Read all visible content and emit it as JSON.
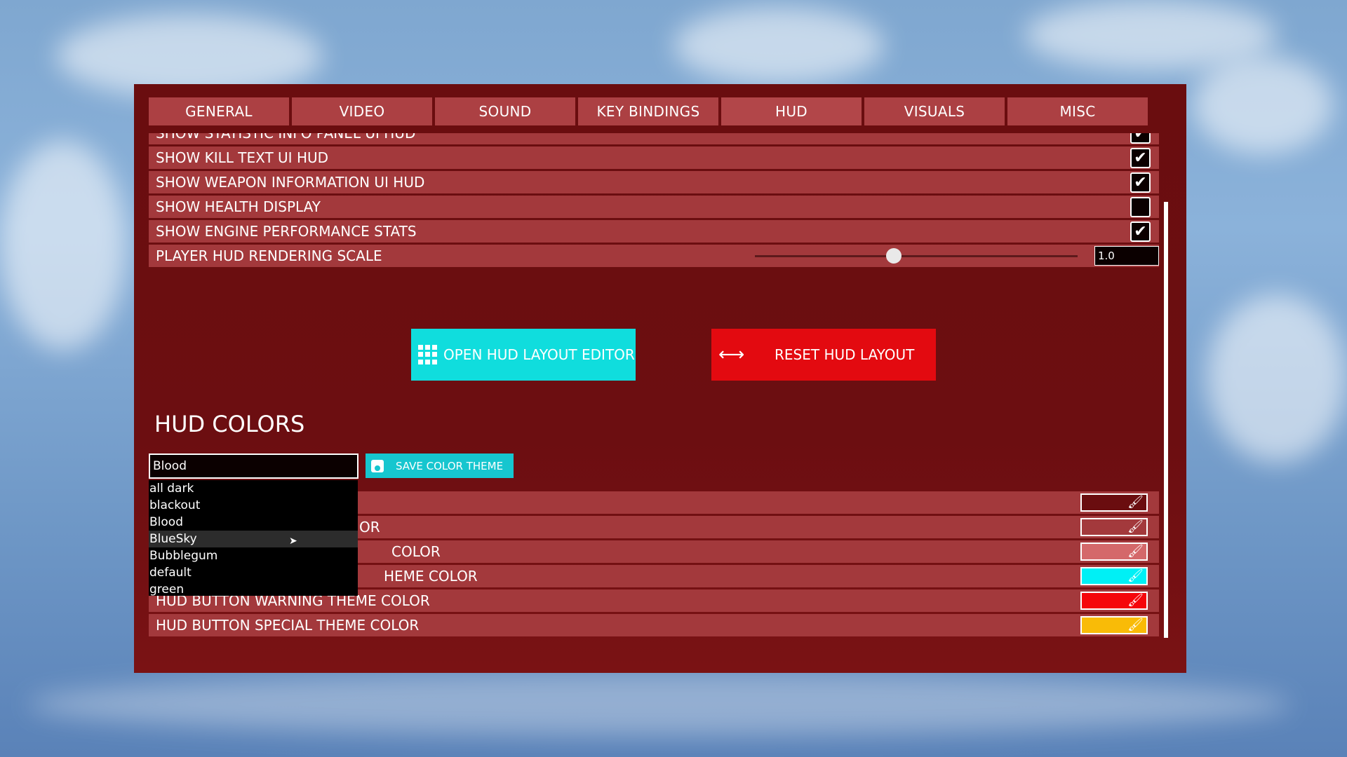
{
  "tabs": [
    "GENERAL",
    "VIDEO",
    "SOUND",
    "KEY BINDINGS",
    "HUD",
    "VISUALS",
    "MISC"
  ],
  "hud_rows": [
    {
      "label": "SHOW STATISTIC INFO PANEL UI HUD",
      "checked": true
    },
    {
      "label": "SHOW KILL TEXT UI HUD",
      "checked": true
    },
    {
      "label": "SHOW WEAPON INFORMATION UI HUD",
      "checked": true
    },
    {
      "label": "SHOW HEALTH DISPLAY",
      "checked": false
    },
    {
      "label": "SHOW ENGINE PERFORMANCE STATS",
      "checked": true
    }
  ],
  "scale": {
    "label": "PLAYER HUD RENDERING SCALE",
    "value": "1.0",
    "slider_fraction": 0.43
  },
  "buttons": {
    "open_editor": "OPEN HUD LAYOUT EDITOR",
    "reset_layout": "RESET HUD LAYOUT",
    "save_theme": "SAVE COLOR THEME"
  },
  "hud_colors": {
    "title": "HUD COLORS",
    "selected_theme": "Blood",
    "theme_options": [
      "all dark",
      "blackout",
      "Blood",
      "BlueSky",
      "Bubblegum",
      "default",
      "green"
    ],
    "hovered_option": "BlueSky",
    "rows": [
      {
        "label": "",
        "color": "#6a0d0f"
      },
      {
        "label": "OR",
        "color": "#a3393c"
      },
      {
        "label": "COLOR",
        "color": "#d4686a"
      },
      {
        "label": "HEME COLOR",
        "color": "#00f0f5"
      },
      {
        "label": "HUD BUTTON WARNING THEME COLOR",
        "color": "#f5060b"
      },
      {
        "label": "HUD BUTTON SPECIAL THEME COLOR",
        "color": "#f9bb07"
      }
    ]
  },
  "icons": {
    "check": "✔",
    "brush": "🖌",
    "arrows": "⟷",
    "cursor": "➤"
  }
}
